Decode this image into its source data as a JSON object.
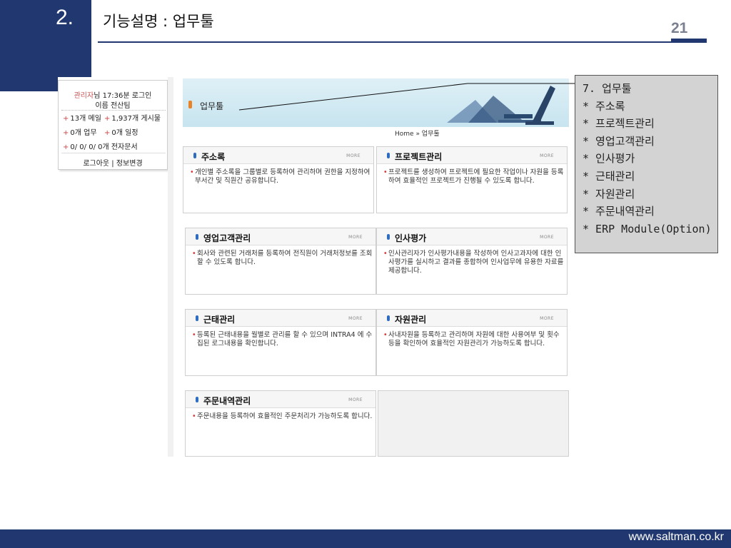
{
  "slide": {
    "section_number": "2.",
    "title": "기능설명 : 업무툴",
    "page_number": "21",
    "footer_url": "www.saltman.co.kr"
  },
  "colors": {
    "navy": "#20386f",
    "note_bg": "#d3d3d3",
    "accent_orange": "#e8832a",
    "bullet_red": "#d33333"
  },
  "login_box": {
    "user": "관리자",
    "user_suffix": "님 17:36분 로그인",
    "team": "이름 전산팀",
    "mail": "13개 메일",
    "posts": "1,937개 게시물",
    "tasks": "0개 업무",
    "schedule": "0개 일정",
    "docs": "0/ 0/ 0/ 0개 전자문서",
    "links": "로그아웃 | 정보변경"
  },
  "banner": {
    "label": "업무툴",
    "breadcrumb": "Home » 업무툴"
  },
  "cards": [
    {
      "title": "주소록",
      "more": "MORE",
      "desc": "개인별 주소록을 그룹별로 등록하여 관리하며 권한을 지정하여 부서간 및 직원간 공유합니다."
    },
    {
      "title": "프로젝트관리",
      "more": "MORE",
      "desc": "프로젝트를 생성하여 프로젝트에 필요한 작업이나 자원을 등록하여 효율적인 프로젝트가 진행될 수 있도록 합니다."
    },
    {
      "title": "영업고객관리",
      "more": "MORE",
      "desc": "회사와 관련된 거래처를 등록하여 전직원이 거래처정보를 조회할 수 있도록 합니다."
    },
    {
      "title": "인사평가",
      "more": "MORE",
      "desc": "인사관리자가 인사평가내용을 작성하여 인사고과자에 대한 인사평가를 실시하고 결과를 종합하여 인사업무에 유용한 자료를 제공합니다."
    },
    {
      "title": "근태관리",
      "more": "MORE",
      "desc": "등록된 근태내용을 월별로 관리를 할 수 있으며 INTRA4 에 수집된 로그내용을 확인합니다."
    },
    {
      "title": "자원관리",
      "more": "MORE",
      "desc": "사내자원을 등록하고 관리하며 자원에 대한 사용여부 및 횟수등을 확인하여 효율적인 자원관리가 가능하도록 합니다."
    },
    {
      "title": "주문내역관리",
      "more": "MORE",
      "desc": "주문내용을 등록하여 효율적인 주문처리가 가능하도록 합니다."
    }
  ],
  "note": {
    "lines": [
      "7. 업무툴",
      " * 주소록",
      " * 프로젝트관리",
      " * 영업고객관리",
      " * 인사평가",
      " * 근태관리",
      " * 자원관리",
      " * 주문내역관리",
      " * ERP Module(Option)"
    ]
  }
}
